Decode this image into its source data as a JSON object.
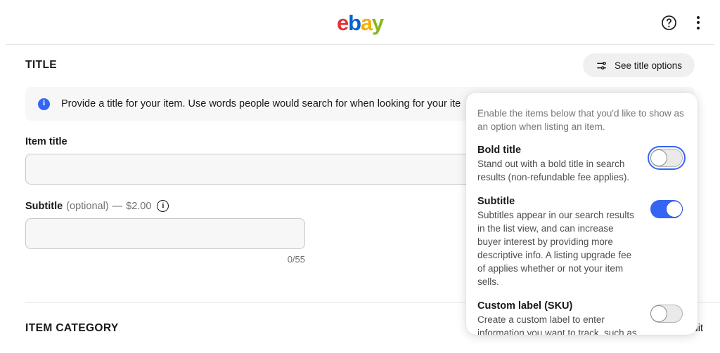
{
  "header": {
    "logo_text": "ebay",
    "logo_letters": [
      "e",
      "b",
      "a",
      "y"
    ],
    "help_icon": "help-circle-icon",
    "menu_icon": "kebab-menu-icon",
    "colors": {
      "e": "#e53238",
      "b": "#0064d2",
      "a": "#f5af02",
      "y": "#86b817"
    }
  },
  "title_section": {
    "heading": "TITLE",
    "options_button": {
      "label": "See title options",
      "icon": "sliders-icon"
    },
    "banner": {
      "icon": "info-filled-icon",
      "text": "Provide a title for your item. Use words people would search for when looking for your ite"
    },
    "item_title": {
      "label": "Item title",
      "value": "",
      "placeholder": ""
    },
    "subtitle": {
      "label_main": "Subtitle",
      "label_optional": "(optional)",
      "label_dash": "—",
      "label_price": "$2.00",
      "info_icon": "info-outline-icon",
      "value": "",
      "placeholder": "",
      "char_count": "0/55"
    }
  },
  "item_category_section": {
    "heading": "ITEM CATEGORY",
    "edit": {
      "label": "Edit",
      "icon": "pencil-icon"
    }
  },
  "popover": {
    "intro": "Enable the items below that you'd like to show as an option when listing an item.",
    "accent_color": "#3665f3",
    "options": [
      {
        "title": "Bold title",
        "description": "Stand out with a bold title in search results (non-refundable fee applies).",
        "toggle_state": "off",
        "focused": true
      },
      {
        "title": "Subtitle",
        "description": "Subtitles appear in our search results in the list view, and can increase buyer interest by providing more descriptive info. A listing upgrade fee of applies whether or not your item sells.",
        "toggle_state": "on",
        "focused": false
      },
      {
        "title": "Custom label (SKU)",
        "description": "Create a custom label to enter information you want to track, such as your own SKU number.",
        "toggle_state": "off",
        "focused": false
      }
    ]
  }
}
